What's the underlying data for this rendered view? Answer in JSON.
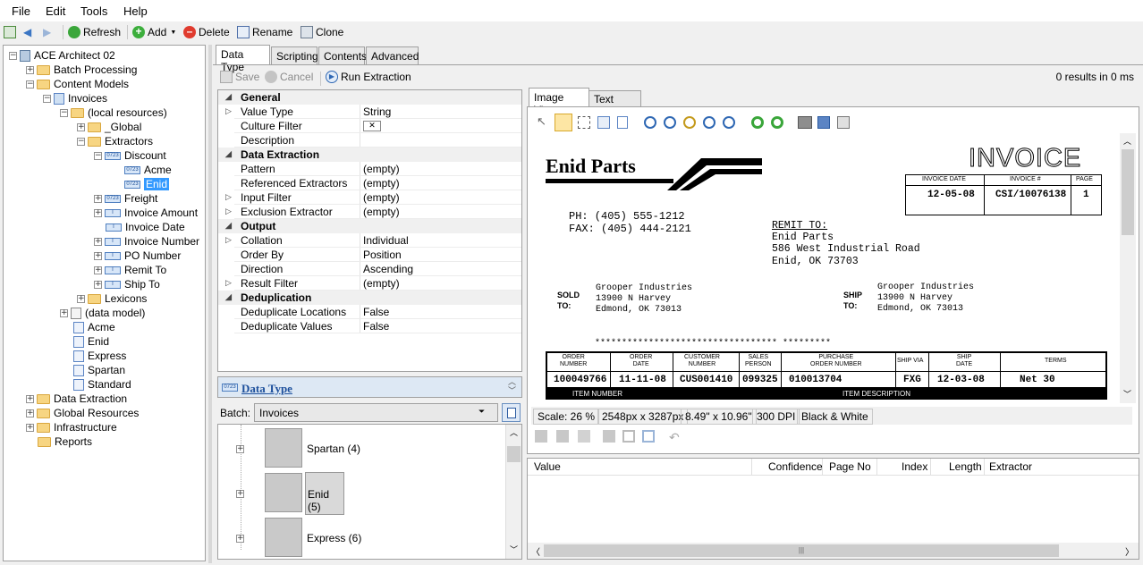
{
  "menu": {
    "file": "File",
    "edit": "Edit",
    "tools": "Tools",
    "help": "Help"
  },
  "toolbar": {
    "refresh": "Refresh",
    "add": "Add",
    "delete": "Delete",
    "rename": "Rename",
    "clone": "Clone"
  },
  "tree": {
    "root": "ACE Architect 02",
    "batch_processing": "Batch Processing",
    "content_models": "Content Models",
    "invoices": "Invoices",
    "local_resources": "(local resources)",
    "global": "_Global",
    "extractors": "Extractors",
    "discount": "Discount",
    "acme": "Acme",
    "enid_sel": "Enid",
    "freight": "Freight",
    "invoice_amount": "Invoice Amount",
    "invoice_date": "Invoice Date",
    "invoice_number": "Invoice Number",
    "po_number": "PO Number",
    "remit_to": "Remit To",
    "ship_to": "Ship To",
    "lexicons": "Lexicons",
    "data_model": "(data model)",
    "m_acme": "Acme",
    "m_enid": "Enid",
    "m_express": "Express",
    "m_spartan": "Spartan",
    "m_standard": "Standard",
    "data_extraction": "Data Extraction",
    "global_resources": "Global Resources",
    "infrastructure": "Infrastructure",
    "reports": "Reports"
  },
  "tabs": {
    "data_type": "Data Type",
    "scripting": "Scripting",
    "contents": "Contents",
    "advanced": "Advanced"
  },
  "actions": {
    "save": "Save",
    "cancel": "Cancel",
    "run": "Run Extraction",
    "results": "0 results in 0 ms"
  },
  "props": {
    "general": "General",
    "value_type": "Value Type",
    "value_type_v": "String",
    "culture_filter": "Culture Filter",
    "description": "Description",
    "data_extraction": "Data Extraction",
    "pattern": "Pattern",
    "pattern_v": "(empty)",
    "ref_extractors": "Referenced Extractors",
    "ref_extractors_v": "(empty)",
    "input_filter": "Input Filter",
    "input_filter_v": "(empty)",
    "exclusion": "Exclusion Extractor",
    "exclusion_v": "(empty)",
    "output": "Output",
    "collation": "Collation",
    "collation_v": "Individual",
    "order_by": "Order By",
    "order_by_v": "Position",
    "direction": "Direction",
    "direction_v": "Ascending",
    "result_filter": "Result Filter",
    "result_filter_v": "(empty)",
    "dedup": "Deduplication",
    "dedup_loc": "Deduplicate Locations",
    "dedup_loc_v": "False",
    "dedup_val": "Deduplicate Values",
    "dedup_val_v": "False"
  },
  "datatype_panel": "Data Type",
  "batch": {
    "label": "Batch:",
    "value": "Invoices",
    "items": [
      "Spartan (4)",
      "Enid (5)",
      "Express (6)"
    ]
  },
  "viewer": {
    "tab_image": "Image View",
    "tab_text": "Text View",
    "scale": "Scale: 26 %",
    "px": "2548px x 3287px",
    "inches": "8.49\" x 10.96\"",
    "dpi": "300 DPI",
    "color": "Black & White"
  },
  "invoice": {
    "company": "Enid Parts",
    "title": "INVOICE",
    "h_date": "INVOICE DATE",
    "h_num": "INVOICE #",
    "h_page": "PAGE",
    "date": "12-05-08",
    "num": "CSI/10076138",
    "page": "1",
    "ph": "PH: (405) 555-1212",
    "fax": "FAX: (405) 444-2121",
    "remit_label": "REMIT TO:",
    "remit_1": "Enid Parts",
    "remit_2": "586 West Industrial Road",
    "remit_3": "Enid, OK 73703",
    "sold_label": "SOLD\nTO:",
    "sold_1": "Grooper Industries",
    "sold_2": "13900 N Harvey",
    "sold_3": "Edmond, OK 73013",
    "ship_label": "SHIP\nTO:",
    "ship_1": "Grooper Industries",
    "ship_2": "13900 N Harvey",
    "ship_3": "Edmond, OK 73013",
    "stars": "********************************** *********",
    "c_order_num": "ORDER\nNUMBER",
    "c_order_date": "ORDER\nDATE",
    "c_customer": "CUSTOMER\nNUMBER",
    "c_sales": "SALES\nPERSON",
    "c_po": "PURCHASE\nORDER NUMBER",
    "c_shipvia": "SHIP VIA",
    "c_shipdate": "SHIP\nDATE",
    "c_terms": "TERMS",
    "v_order_num": "100049766",
    "v_order_date": "11-11-08",
    "v_customer": "CUS001410",
    "v_sales": "099325",
    "v_po": "010013704",
    "v_shipvia": "FXG",
    "v_shipdate": "12-03-08",
    "v_terms": "Net 30",
    "item_number": "ITEM NUMBER",
    "item_desc": "ITEM DESCRIPTION"
  },
  "results_cols": {
    "value": "Value",
    "confidence": "Confidence",
    "page": "Page No",
    "index": "Index",
    "length": "Length",
    "extractor": "Extractor"
  }
}
